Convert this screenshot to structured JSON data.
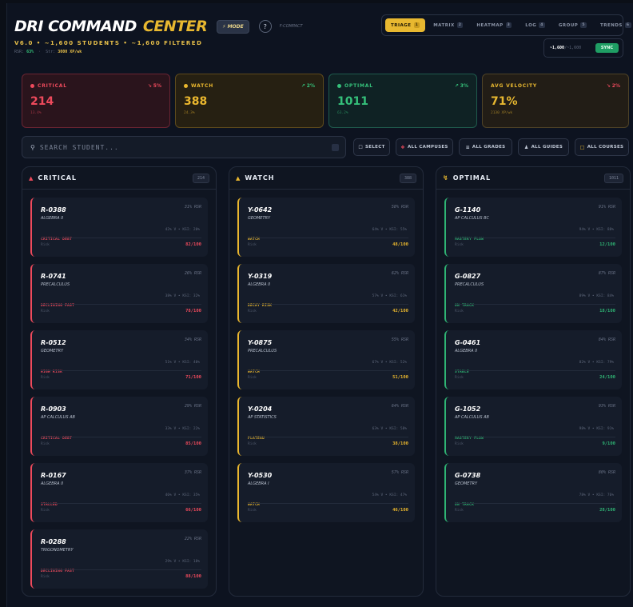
{
  "header": {
    "title_a": "DRI COMMAND",
    "title_b": "CENTER",
    "mode_label": "⚡ MODE",
    "help_label": "?",
    "compact_label": "F:COMPACT",
    "subtitle": "V6.0 • ~1,600 STUDENTS • ~1,600 FILTERED",
    "rsr_label": "RSR:",
    "rsr_value": "63%",
    "sv_label": "Str:",
    "sv_value": "3000 XP/wk"
  },
  "tabs": [
    {
      "label": "TRIAGE",
      "key": "1",
      "active": true
    },
    {
      "label": "MATRIX",
      "key": "2"
    },
    {
      "label": "HEATMAP",
      "key": "3"
    },
    {
      "label": "LOG",
      "key": "4"
    },
    {
      "label": "GROUP",
      "key": "5"
    },
    {
      "label": "TRENDS",
      "key": "6"
    }
  ],
  "sync": {
    "count": "~1,600",
    "total": "/~1,600",
    "button": "SYNC"
  },
  "stats": {
    "critical": {
      "label": "CRITICAL",
      "change": "↘ 5%",
      "value": "214",
      "sub": "13.4%"
    },
    "watch": {
      "label": "WATCH",
      "change": "↗ 2%",
      "value": "388",
      "sub": "24.3%"
    },
    "optimal": {
      "label": "OPTIMAL",
      "change": "↗ 3%",
      "value": "1011",
      "sub": "63.2%"
    },
    "velocity": {
      "label": "AVG VELOCITY",
      "change": "↘ 2%",
      "value": "71%",
      "sub": "2130 XP/wk"
    }
  },
  "filters": {
    "search_placeholder": "SEARCH STUDENT...",
    "select": "SELECT",
    "campuses": "ALL CAMPUSES",
    "grades": "ALL GRADES",
    "guides": "ALL GUIDES",
    "courses": "ALL COURSES"
  },
  "columns": {
    "critical": {
      "title": "CRITICAL",
      "count": "214",
      "cards": [
        {
          "id": "R-0388",
          "rsr": "31% RSR",
          "subject": "ALGEBRA II",
          "tag": "CRITICAL DEBT",
          "meta": "42% V • KSI: 20%",
          "foot": "Risk",
          "score": "82/100"
        },
        {
          "id": "R-0741",
          "rsr": "26% RSR",
          "subject": "PRECALCULUS",
          "tag": "DECLINING FAST",
          "meta": "38% V • KSI: 32%",
          "foot": "Risk",
          "score": "78/100"
        },
        {
          "id": "R-0512",
          "rsr": "34% RSR",
          "subject": "GEOMETRY",
          "tag": "HIGH RISK",
          "meta": "51% V • KSI: 40%",
          "foot": "Risk",
          "score": "71/100"
        },
        {
          "id": "R-0903",
          "rsr": "29% RSR",
          "subject": "AP CALCULUS AB",
          "tag": "CRITICAL DEBT",
          "meta": "33% V • KSI: 22%",
          "foot": "Risk",
          "score": "85/100"
        },
        {
          "id": "R-0167",
          "rsr": "37% RSR",
          "subject": "ALGEBRA II",
          "tag": "STALLED",
          "meta": "46% V • KSI: 35%",
          "foot": "Risk",
          "score": "66/100"
        },
        {
          "id": "R-0288",
          "rsr": "22% RSR",
          "subject": "TRIGONOMETRY",
          "tag": "DECLINING FAST",
          "meta": "29% V • KSI: 18%",
          "foot": "Risk",
          "score": "88/100"
        }
      ]
    },
    "watch": {
      "title": "WATCH",
      "count": "388",
      "cards": [
        {
          "id": "Y-0642",
          "rsr": "58% RSR",
          "subject": "GEOMETRY",
          "tag": "WATCH",
          "meta": "64% V • KSI: 55%",
          "foot": "Risk",
          "score": "48/100"
        },
        {
          "id": "Y-0319",
          "rsr": "62% RSR",
          "subject": "ALGEBRA II",
          "tag": "DECAY RISK",
          "meta": "57% V • KSI: 61%",
          "foot": "Risk",
          "score": "42/100"
        },
        {
          "id": "Y-0875",
          "rsr": "55% RSR",
          "subject": "PRECALCULUS",
          "tag": "WATCH",
          "meta": "67% V • KSI: 52%",
          "foot": "Risk",
          "score": "51/100"
        },
        {
          "id": "Y-0204",
          "rsr": "64% RSR",
          "subject": "AP STATISTICS",
          "tag": "PLATEAU",
          "meta": "63% V • KSI: 58%",
          "foot": "Risk",
          "score": "38/100"
        },
        {
          "id": "Y-0530",
          "rsr": "57% RSR",
          "subject": "ALGEBRA I",
          "tag": "WATCH",
          "meta": "54% V • KSI: 47%",
          "foot": "Risk",
          "score": "46/100"
        }
      ]
    },
    "optimal": {
      "title": "OPTIMAL",
      "count": "1011",
      "cards": [
        {
          "id": "G-1140",
          "rsr": "91% RSR",
          "subject": "AP CALCULUS BC",
          "tag": "MASTERY FLOW",
          "meta": "94% V • KSI: 88%",
          "foot": "Risk",
          "score": "12/100"
        },
        {
          "id": "G-0827",
          "rsr": "87% RSR",
          "subject": "PRECALCULUS",
          "tag": "ON TRACK",
          "meta": "89% V • KSI: 84%",
          "foot": "Risk",
          "score": "18/100"
        },
        {
          "id": "G-0461",
          "rsr": "84% RSR",
          "subject": "ALGEBRA II",
          "tag": "STABLE",
          "meta": "82% V • KSI: 79%",
          "foot": "Risk",
          "score": "24/100"
        },
        {
          "id": "G-1052",
          "rsr": "93% RSR",
          "subject": "AP CALCULUS AB",
          "tag": "MASTERY FLOW",
          "meta": "98% V • KSI: 91%",
          "foot": "Risk",
          "score": "9/100"
        },
        {
          "id": "G-0738",
          "rsr": "80% RSR",
          "subject": "GEOMETRY",
          "tag": "ON TRACK",
          "meta": "78% V • KSI: 76%",
          "foot": "Risk",
          "score": "28/100"
        }
      ]
    }
  }
}
